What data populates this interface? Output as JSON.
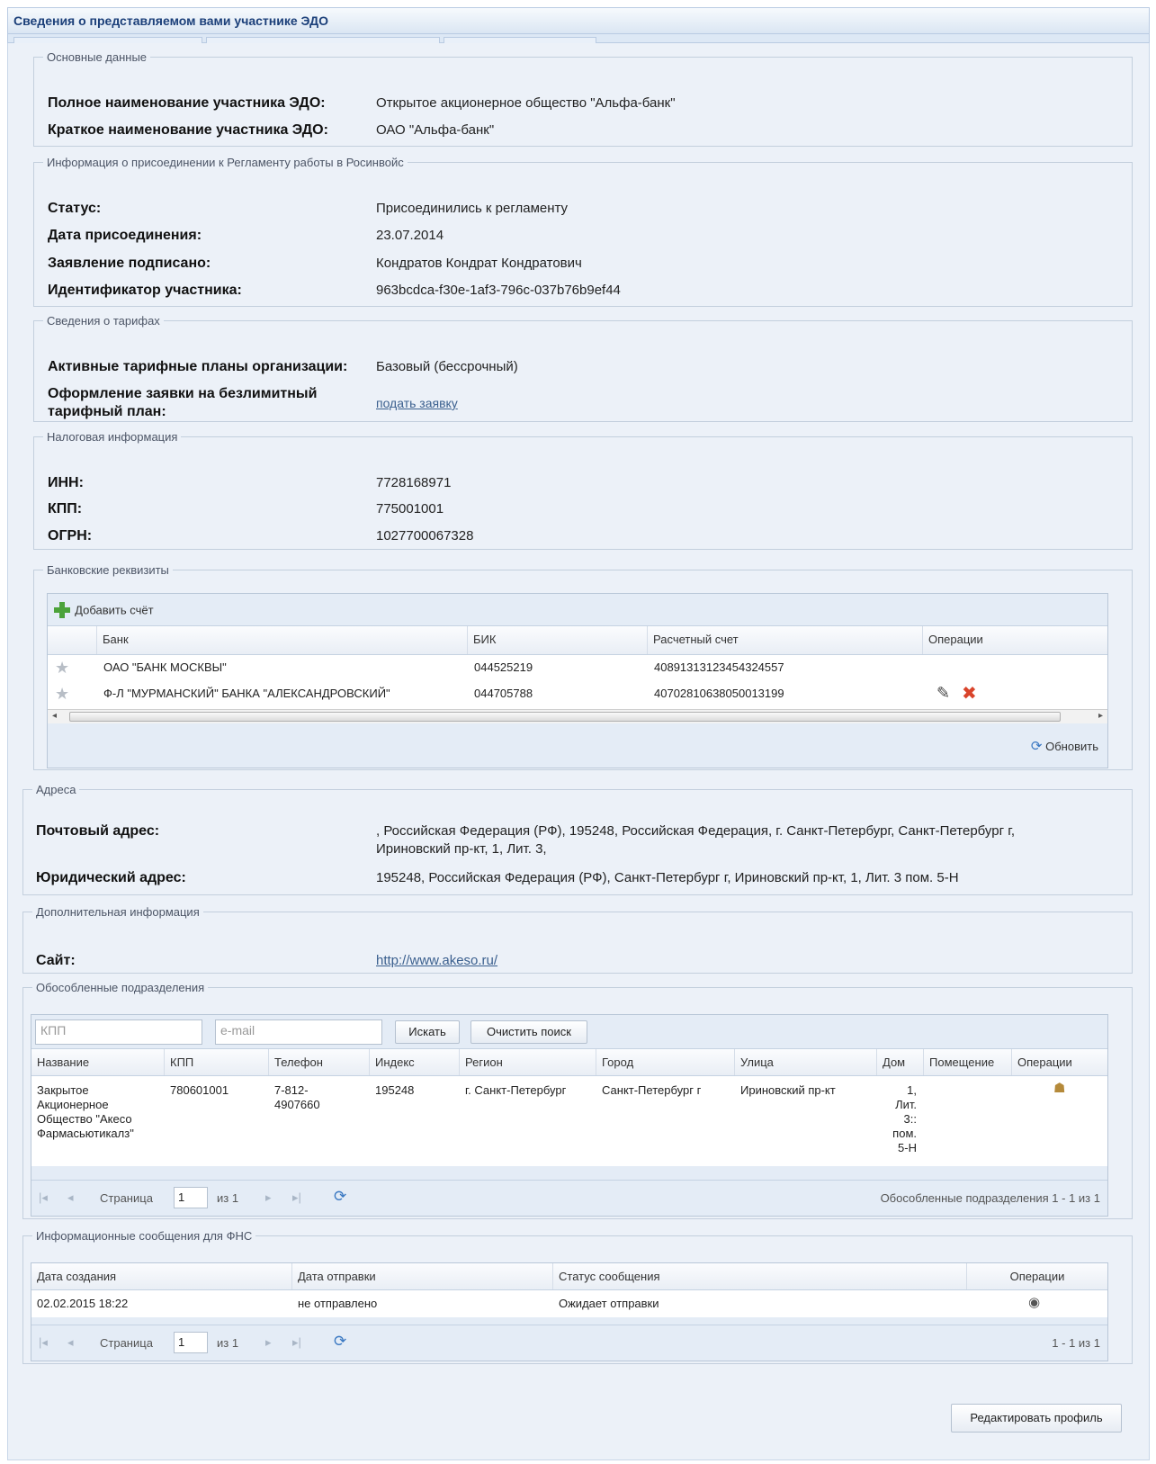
{
  "window": {
    "title": "Сведения о представляемом вами участнике ЭДО"
  },
  "basic": {
    "legend": "Основные данные",
    "full_name_label": "Полное наименование участника ЭДО:",
    "full_name_value": "Открытое акционерное общество \"Альфа-банк\"",
    "short_name_label": "Краткое наименование участника ЭДО:",
    "short_name_value": "ОАО \"Альфа-банк\""
  },
  "join": {
    "legend": "Информация о присоединении к Регламенту работы в Росинвойс",
    "status_label": "Статус:",
    "status_value": "Присоединились к регламенту",
    "date_label": "Дата присоединения:",
    "date_value": "23.07.2014",
    "signed_label": "Заявление подписано:",
    "signed_value": "Кондратов Кондрат Кондратович",
    "id_label": "Идентификатор участника:",
    "id_value": "963bcdca-f30e-1af3-796c-037b76b9ef44"
  },
  "tariffs": {
    "legend": "Сведения о тарифах",
    "active_label": "Активные тарифные планы организации:",
    "active_value": "Базовый (бессрочный)",
    "unlimited_label_1": "Оформление заявки на безлимитный",
    "unlimited_label_2": "тарифный план:",
    "apply_link": "подать заявку"
  },
  "tax": {
    "legend": "Налоговая информация",
    "inn_label": "ИНН:",
    "inn_value": "7728168971",
    "kpp_label": "КПП:",
    "kpp_value": "775001001",
    "ogrn_label": "ОГРН:",
    "ogrn_value": "1027700067328"
  },
  "bank": {
    "legend": "Банковские реквизиты",
    "add_label": "Добавить счёт",
    "columns": [
      "Банк",
      "БИК",
      "Расчетный счет",
      "Операции"
    ],
    "rows": [
      {
        "bank": "ОАО \"БАНК МОСКВЫ\"",
        "bik": "044525219",
        "account": "40891313123454324557"
      },
      {
        "bank": "Ф-Л \"МУРМАНСКИЙ\" БАНКА \"АЛЕКСАНДРОВСКИЙ\"",
        "bik": "044705788",
        "account": "40702810638050013199"
      }
    ],
    "refresh_label": "Обновить"
  },
  "addresses": {
    "legend": "Адреса",
    "postal_label": "Почтовый адрес:",
    "postal_value_1": ", Российская Федерация (РФ), 195248, Российская Федерация, г. Санкт-Петербург, Санкт-Петербург г,",
    "postal_value_2": "Ириновский пр-кт, 1, Лит. 3,",
    "legal_label": "Юридический адрес:",
    "legal_value": "195248, Российская Федерация (РФ), Санкт-Петербург г, Ириновский пр-кт, 1, Лит. 3 пом. 5-Н"
  },
  "extra": {
    "legend": "Дополнительная информация",
    "site_label": "Сайт:",
    "site_value": "http://www.akeso.ru/"
  },
  "branches": {
    "legend": "Обособленные подразделения",
    "kpp_placeholder": "КПП",
    "email_placeholder": "e-mail",
    "search_label": "Искать",
    "clear_label": "Очистить поиск",
    "columns": [
      "Название",
      "КПП",
      "Телефон",
      "Индекс",
      "Регион",
      "Город",
      "Улица",
      "Дом",
      "Помещение",
      "Операции"
    ],
    "row": {
      "name_lines": [
        "Закрытое",
        "Акционерное",
        "Общество \"Акесо",
        "Фармасьютикалз\""
      ],
      "kpp": "780601001",
      "phone_lines": [
        "7-812-",
        "4907660"
      ],
      "index": "195248",
      "region": "г. Санкт-Петербург",
      "city": "Санкт-Петербург г",
      "street": "Ириновский пр-кт",
      "house_lines": [
        "1,",
        "Лит.",
        "3::",
        "пом.",
        "5-Н"
      ]
    },
    "pager": {
      "page_label": "Страница",
      "page": "1",
      "of": "из 1",
      "summary": "Обособленные подразделения 1 - 1 из 1"
    }
  },
  "fns": {
    "legend": "Информационные сообщения для ФНС",
    "columns": [
      "Дата создания",
      "Дата отправки",
      "Статус сообщения",
      "Операции"
    ],
    "row": {
      "created": "02.02.2015 18:22",
      "sent": "не отправлено",
      "status": "Ожидает отправки"
    },
    "pager": {
      "page_label": "Страница",
      "page": "1",
      "of": "из 1",
      "summary": "1 - 1 из 1"
    }
  },
  "edit_profile_label": "Редактировать профиль",
  "colors": {
    "title": "#1b3f79",
    "panel": "#ecf1f8",
    "link": "#3a5f8e",
    "delete": "#d9442b"
  }
}
